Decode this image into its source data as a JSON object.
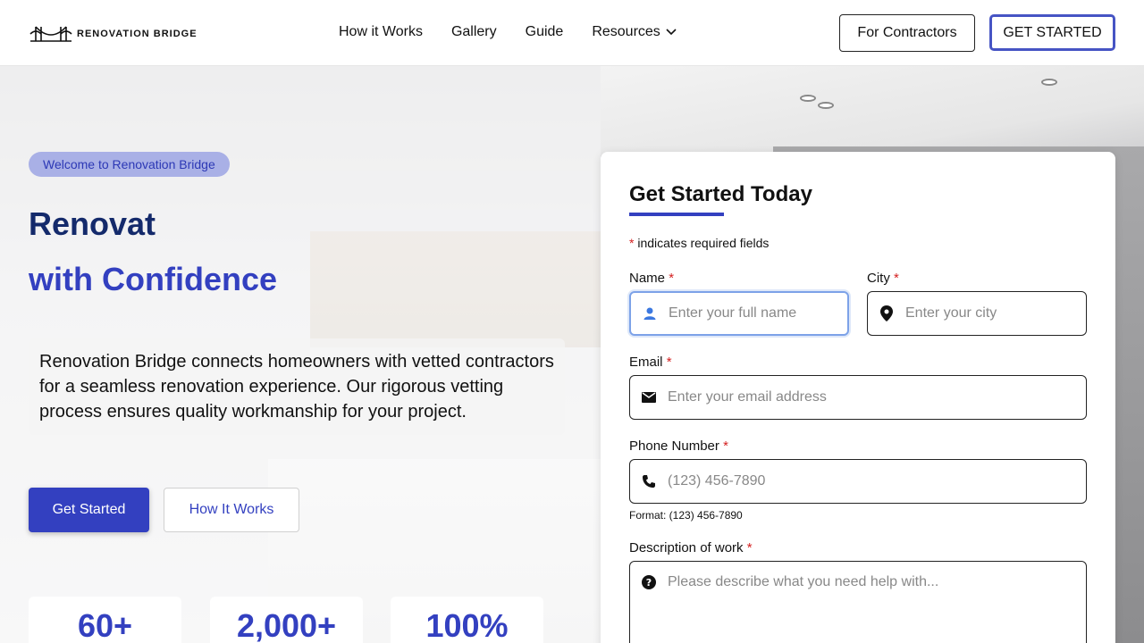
{
  "header": {
    "logo_text": "RENOVATION BRIDGE",
    "nav": [
      "How it Works",
      "Gallery",
      "Guide",
      "Resources"
    ],
    "for_contractors": "For Contractors",
    "get_started": "GET STARTED"
  },
  "hero": {
    "badge": "Welcome to Renovation Bridge",
    "headline_line1": "Renovat",
    "headline_line2": "with Confidence",
    "description": "Renovation Bridge connects homeowners with vetted contractors for a seamless renovation experience. Our rigorous vetting process ensures quality workmanship for your project.",
    "primary_button": "Get Started",
    "secondary_button": "How It Works",
    "stats": [
      "60+",
      "2,000+",
      "100%"
    ]
  },
  "form": {
    "title": "Get Started Today",
    "required_note_star": "*",
    "required_note": " indicates required fields",
    "name_label": "Name",
    "name_placeholder": "Enter your full name",
    "city_label": "City",
    "city_placeholder": "Enter your city",
    "email_label": "Email",
    "email_placeholder": "Enter your email address",
    "phone_label": "Phone Number",
    "phone_placeholder": "(123) 456-7890",
    "phone_format": "Format: (123) 456-7890",
    "description_label": "Description of work",
    "description_placeholder": "Please describe what you need help with..."
  },
  "colors": {
    "accent": "#3340c0",
    "headline_dark": "#142a6b",
    "badge_bg": "#a9b0e6",
    "required": "#d42020"
  }
}
